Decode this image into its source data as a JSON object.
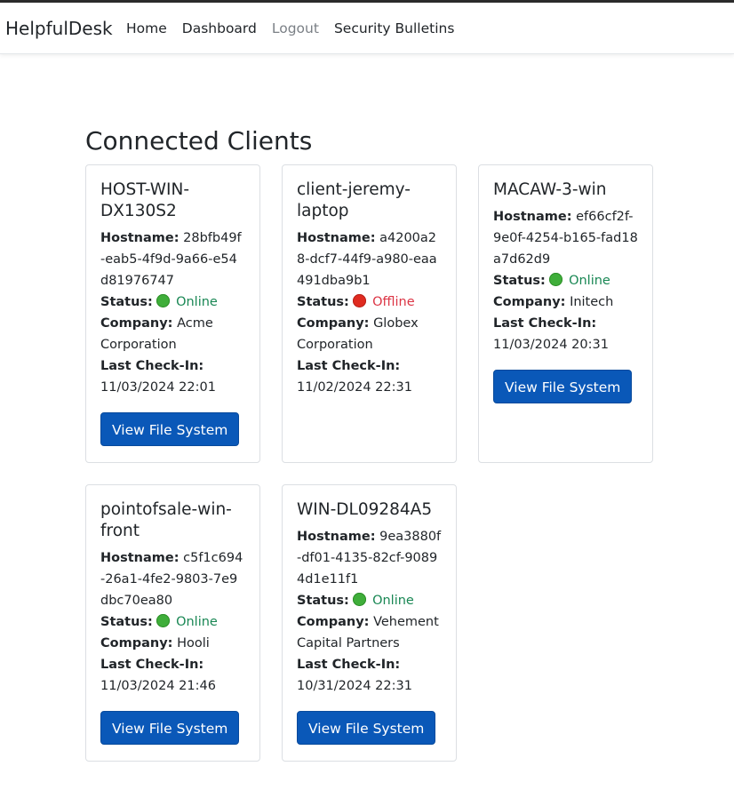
{
  "nav": {
    "brand": "HelpfulDesk",
    "links": [
      "Home",
      "Dashboard",
      "Logout",
      "Security Bulletins"
    ]
  },
  "page": {
    "title": "Connected Clients"
  },
  "labels": {
    "hostname": "Hostname:",
    "status": "Status:",
    "company": "Company:",
    "last_check_in": "Last Check-In:",
    "button": "View File System"
  },
  "clients": [
    {
      "name": "HOST-WIN-DX130S2",
      "hostname": "28bfb49f-eab5-4f9d-9a66-e54d81976747",
      "status": "Online",
      "company": "Acme Corporation",
      "last_check_in": "11/03/2024 22:01"
    },
    {
      "name": "client-jeremy-laptop",
      "hostname": "a4200a28-dcf7-44f9-a980-eaa491dba9b1",
      "status": "Offline",
      "company": "Globex Corporation",
      "last_check_in": "11/02/2024 22:31"
    },
    {
      "name": "MACAW-3-win",
      "hostname": "ef66cf2f-9e0f-4254-b165-fad18a7d62d9",
      "status": "Online",
      "company": "Initech",
      "last_check_in": "11/03/2024 20:31"
    },
    {
      "name": "pointofsale-win-front",
      "hostname": "c5f1c694-26a1-4fe2-9803-7e9dbc70ea80",
      "status": "Online",
      "company": "Hooli",
      "last_check_in": "11/03/2024 21:46"
    },
    {
      "name": "WIN-DL09284A5",
      "hostname": "9ea3880f-df01-4135-82cf-90894d1e11f1",
      "status": "Online",
      "company": "Vehement Capital Partners",
      "last_check_in": "10/31/2024 22:31"
    }
  ],
  "colors": {
    "online": "#198754",
    "offline": "#dc3545",
    "button": "#0a58b8"
  }
}
